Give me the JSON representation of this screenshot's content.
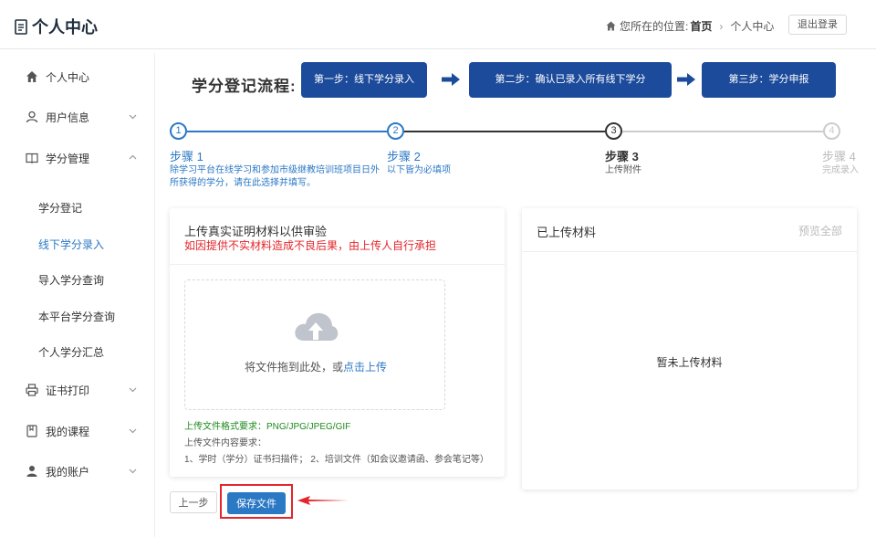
{
  "header": {
    "title": "个人中心",
    "location_label": "您所在的位置:",
    "crumb_home": "首页",
    "crumb_current": "个人中心",
    "logout_label": "退出登录"
  },
  "sidebar": {
    "items": [
      {
        "label": "个人中心",
        "icon": "home-icon"
      },
      {
        "label": "用户信息",
        "icon": "user-icon"
      },
      {
        "label": "学分管理",
        "icon": "book-icon"
      },
      {
        "label": "证书打印",
        "icon": "printer-icon"
      },
      {
        "label": "我的课程",
        "icon": "bookmark-icon"
      },
      {
        "label": "我的账户",
        "icon": "account-icon"
      }
    ],
    "sub_items": [
      {
        "label": "学分登记"
      },
      {
        "label": "线下学分录入",
        "active": true
      },
      {
        "label": "导入学分查询"
      },
      {
        "label": "本平台学分查询"
      },
      {
        "label": "个人学分汇总"
      }
    ]
  },
  "flow": {
    "label": "学分登记流程:",
    "steps": [
      "第一步：线下学分录入",
      "第二步：确认已录入所有线下学分",
      "第三步：学分申报"
    ]
  },
  "steps": [
    {
      "num": "1",
      "title": "步骤 1",
      "desc_line1": "除学习平台在线学习和参加市级继教培训班项目日外",
      "desc_line2": "所获得的学分，请在此选择并填写。"
    },
    {
      "num": "2",
      "title": "步骤 2",
      "desc_line1": "以下皆为必填项"
    },
    {
      "num": "3",
      "title": "步骤 3",
      "desc_line1": "上传附件"
    },
    {
      "num": "4",
      "title": "步骤 4",
      "desc_line1": "完成录入"
    }
  ],
  "upload": {
    "title": "上传真实证明材料以供审验",
    "warning": "如因提供不实材料造成不良后果，由上传人自行承担",
    "hint_prefix": "将文件拖到此处，或",
    "hint_link": "点击上传",
    "req_format": "上传文件格式要求：PNG/JPG/JPEG/GIF",
    "req_content_title": "上传文件内容要求：",
    "req_content": "1、学时（学分）证书扫描件；  2、培训文件（如会议邀请函、参会笔记等）"
  },
  "uploaded": {
    "title": "已上传材料",
    "preview_all": "预览全部",
    "empty": "暂未上传材料"
  },
  "actions": {
    "prev_label": "上一步",
    "save_label": "保存文件"
  },
  "colors": {
    "primary": "#2b78c5",
    "flow_step": "#1d4b9b",
    "warning": "#e3262b",
    "success": "#1e8a1e"
  }
}
